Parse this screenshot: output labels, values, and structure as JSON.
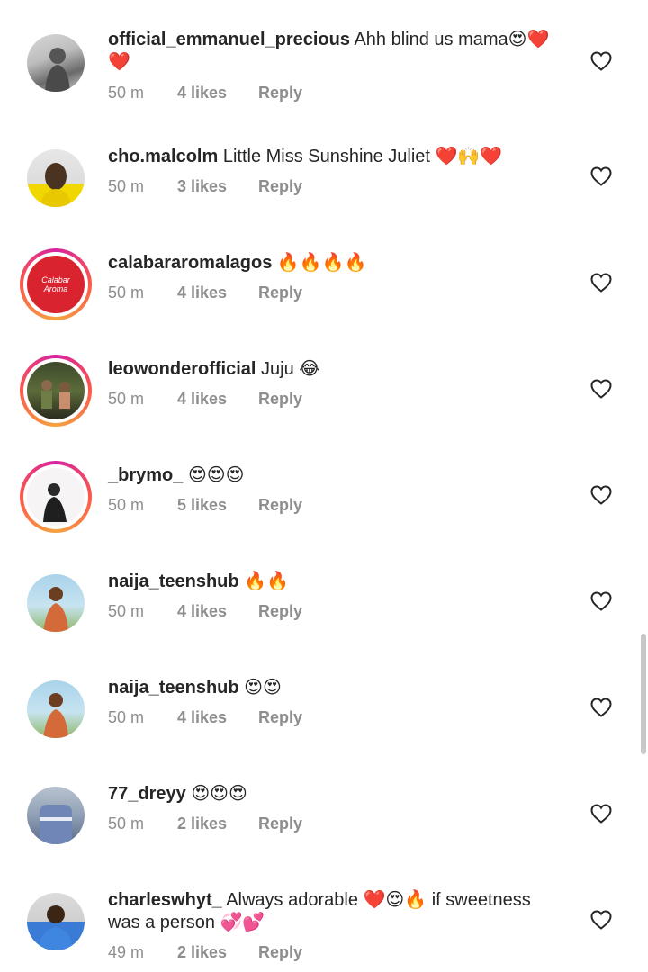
{
  "comments": [
    {
      "username": "official_emmanuel_precious",
      "text": "Ahh blind us mama😍❤️❤️",
      "time": "50 m",
      "likes": "4 likes",
      "reply": "Reply"
    },
    {
      "username": "cho.malcolm",
      "text": "Little Miss Sunshine Juliet ❤️🙌❤️",
      "time": "50 m",
      "likes": "3 likes",
      "reply": "Reply"
    },
    {
      "username": "calabararomalagos",
      "text": "🔥🔥🔥🔥",
      "time": "50 m",
      "likes": "4 likes",
      "reply": "Reply",
      "avatar_text": "Calabar Aroma"
    },
    {
      "username": "leowonderofficial",
      "text": "Juju 😂",
      "time": "50 m",
      "likes": "4 likes",
      "reply": "Reply"
    },
    {
      "username": "_brymo_",
      "text": "😍😍😍",
      "time": "50 m",
      "likes": "5 likes",
      "reply": "Reply"
    },
    {
      "username": "naija_teenshub",
      "text": "🔥🔥",
      "time": "50 m",
      "likes": "4 likes",
      "reply": "Reply"
    },
    {
      "username": "naija_teenshub",
      "text": "😍😍",
      "time": "50 m",
      "likes": "4 likes",
      "reply": "Reply"
    },
    {
      "username": "77_dreyy",
      "text": "😍😍😍",
      "time": "50 m",
      "likes": "2 likes",
      "reply": "Reply"
    },
    {
      "username": "charleswhyt_",
      "text": "Always adorable ❤️😍🔥 if sweetness was a person 💞💕",
      "time": "49 m",
      "likes": "2 likes",
      "reply": "Reply"
    }
  ],
  "icons": {
    "like": "heart-outline-icon"
  },
  "colors": {
    "meta": "#8e8e8e",
    "ring_start": "#d6249f",
    "ring_end": "#f4a442",
    "brand_red": "#d9232e"
  }
}
